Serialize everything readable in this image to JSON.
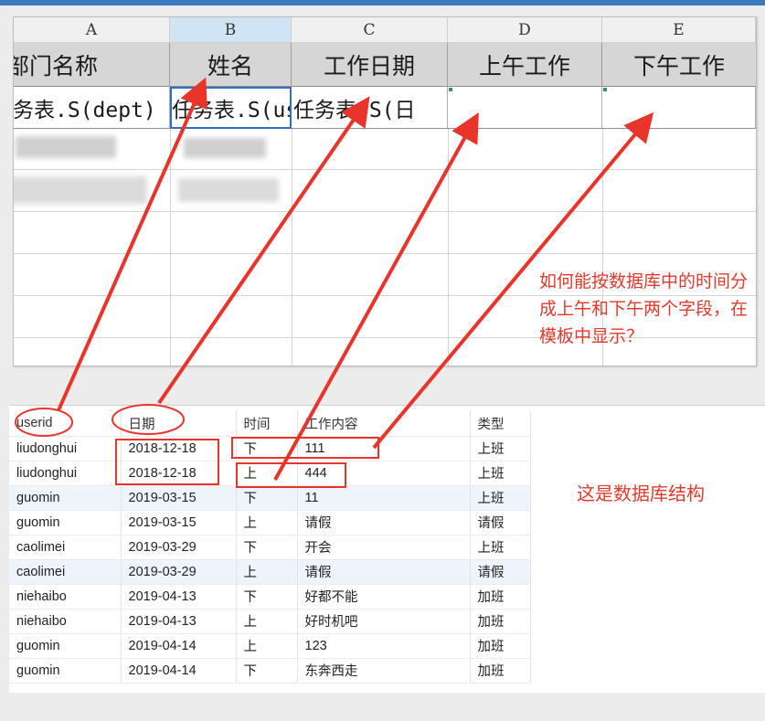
{
  "spreadsheet": {
    "column_letters": [
      "A",
      "B",
      "C",
      "D",
      "E"
    ],
    "field_headers": [
      "部门名称",
      "姓名",
      "工作日期",
      "上午工作",
      "下午工作"
    ],
    "template_cells": [
      "任务表.S(dept)",
      "任务表.S(userid)",
      "任务表.S(日",
      "",
      ""
    ],
    "question": "如何能按数据库中的时间分成上午和下午两个字段，在模板中显示？"
  },
  "database": {
    "caption": "这是数据库结构",
    "columns": [
      "userid",
      "日期",
      "时间",
      "工作内容",
      "类型"
    ],
    "rows": [
      [
        "liudonghui",
        "2018-12-18",
        "下",
        "111",
        "上班"
      ],
      [
        "liudonghui",
        "2018-12-18",
        "上",
        "444",
        "上班"
      ],
      [
        "guomin",
        "2019-03-15",
        "下",
        "11",
        "上班"
      ],
      [
        "guomin",
        "2019-03-15",
        "上",
        "请假",
        "请假"
      ],
      [
        "caolimei",
        "2019-03-29",
        "下",
        "开会",
        "上班"
      ],
      [
        "caolimei",
        "2019-03-29",
        "上",
        "请假",
        "请假"
      ],
      [
        "niehaibo",
        "2019-04-13",
        "下",
        "好都不能",
        "加班"
      ],
      [
        "niehaibo",
        "2019-04-13",
        "上",
        "好时机吧",
        "加班"
      ],
      [
        "guomin",
        "2019-04-14",
        "上",
        "123",
        "加班"
      ],
      [
        "guomin",
        "2019-04-14",
        "下",
        "东奔西走",
        "加班"
      ]
    ]
  },
  "colors": {
    "annotation": "#e8342a",
    "accent_bar": "#3b78c2",
    "selected_column": "#cfe4f4"
  }
}
